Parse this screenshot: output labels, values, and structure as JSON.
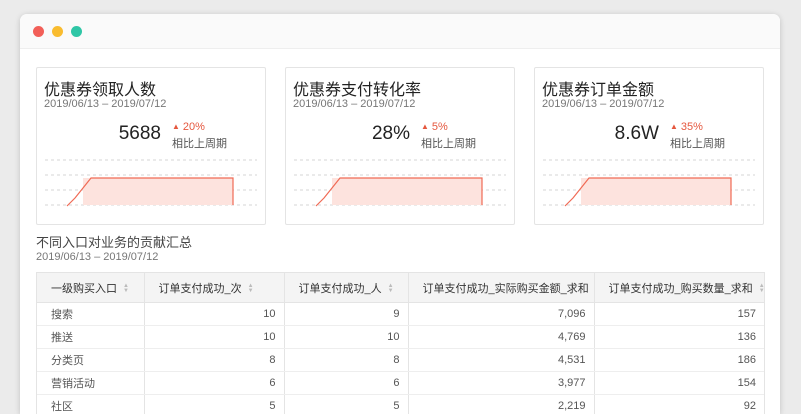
{
  "window": {
    "controls": [
      "close",
      "minimize",
      "maximize"
    ],
    "colors": {
      "close": "#f25f58",
      "minimize": "#f9bc2f",
      "maximize": "#2fc6a6"
    }
  },
  "cards": [
    {
      "title": "优惠券领取人数",
      "date": "2019/06/13 – 2019/07/12",
      "value": "5688",
      "change": "20%",
      "compare": "相比上周期",
      "icon": "triangle-up-icon"
    },
    {
      "title": "优惠券支付转化率",
      "date": "2019/06/13 – 2019/07/12",
      "value": "28%",
      "change": "5%",
      "compare": "相比上周期",
      "icon": "triangle-up-icon"
    },
    {
      "title": "优惠券订单金额",
      "date": "2019/06/13 – 2019/07/12",
      "value": "8.6W",
      "change": "35%",
      "compare": "相比上周期",
      "icon": "triangle-up-icon"
    }
  ],
  "accent_color": "#f06a55",
  "section": {
    "title": "不同入口对业务的贡献汇总",
    "date": "2019/06/13 – 2019/07/12"
  },
  "table": {
    "columns": [
      "一级购买入口",
      "订单支付成功_次",
      "订单支付成功_人",
      "订单支付成功_实际购买金额_求和",
      "订单支付成功_购买数量_求和"
    ],
    "rows": [
      [
        "搜索",
        "10",
        "9",
        "7,096",
        "157"
      ],
      [
        "推送",
        "10",
        "10",
        "4,769",
        "136"
      ],
      [
        "分类页",
        "8",
        "8",
        "4,531",
        "186"
      ],
      [
        "营销活动",
        "6",
        "6",
        "3,977",
        "154"
      ],
      [
        "社区",
        "5",
        "5",
        "2,219",
        "92"
      ]
    ]
  }
}
